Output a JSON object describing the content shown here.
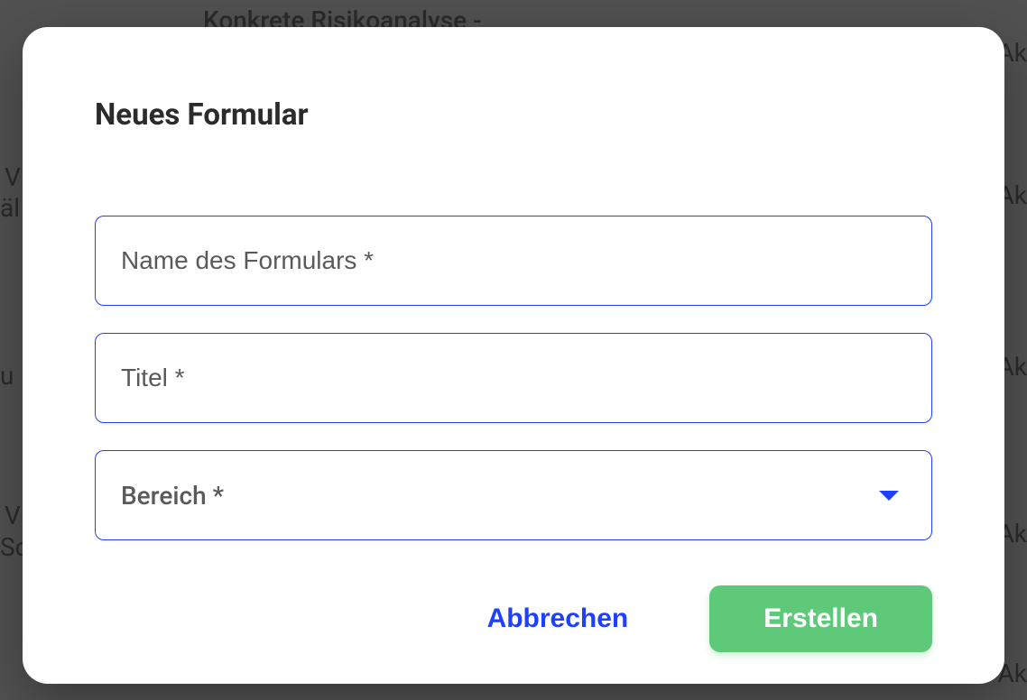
{
  "background": {
    "header_text": "Konkrete Risikoanalyse -",
    "left_text_1": "V",
    "left_text_2": "äl",
    "left_text_3": "u",
    "left_text_4": "V",
    "left_text_5": "Sc",
    "right_text": "Ak"
  },
  "modal": {
    "title": "Neues Formular",
    "fields": {
      "name": {
        "placeholder": "Name des Formulars *",
        "value": ""
      },
      "title": {
        "placeholder": "Titel *",
        "value": ""
      },
      "area": {
        "label": "Bereich *",
        "value": ""
      }
    },
    "actions": {
      "cancel": "Abbrechen",
      "create": "Erstellen"
    }
  }
}
